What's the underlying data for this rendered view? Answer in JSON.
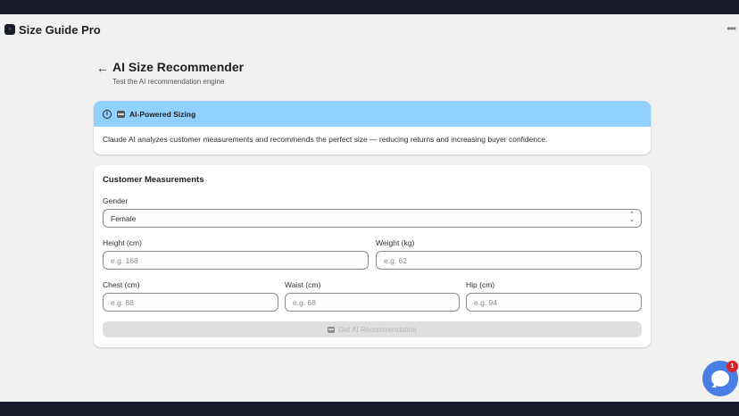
{
  "app": {
    "title": "Size Guide Pro",
    "more_icon": "more-horizontal-icon"
  },
  "page": {
    "title": "AI Size Recommender",
    "subtitle": "Test the AI recommendation engine",
    "back_icon": "arrow-left-icon"
  },
  "banner": {
    "title": "AI-Powered Sizing",
    "body": "Claude AI analyzes customer measurements and recommends the perfect size — reducing returns and increasing buyer confidence.",
    "icons": [
      "info-icon",
      "robot-icon"
    ],
    "color": "#91d0ff"
  },
  "form": {
    "title": "Customer Measurements",
    "gender": {
      "label": "Gender",
      "value": "Female"
    },
    "height": {
      "label": "Height (cm)",
      "placeholder": "e.g. 168"
    },
    "weight": {
      "label": "Weight (kg)",
      "placeholder": "e.g. 62"
    },
    "chest": {
      "label": "Chest (cm)",
      "placeholder": "e.g. 88"
    },
    "waist": {
      "label": "Waist (cm)",
      "placeholder": "e.g. 68"
    },
    "hip": {
      "label": "Hip (cm)",
      "placeholder": "e.g. 94"
    },
    "submit_label": "Get AI Recommendation"
  },
  "chat": {
    "badge_count": "1",
    "accent": "#4a7de6",
    "badge_color": "#d9262c"
  }
}
